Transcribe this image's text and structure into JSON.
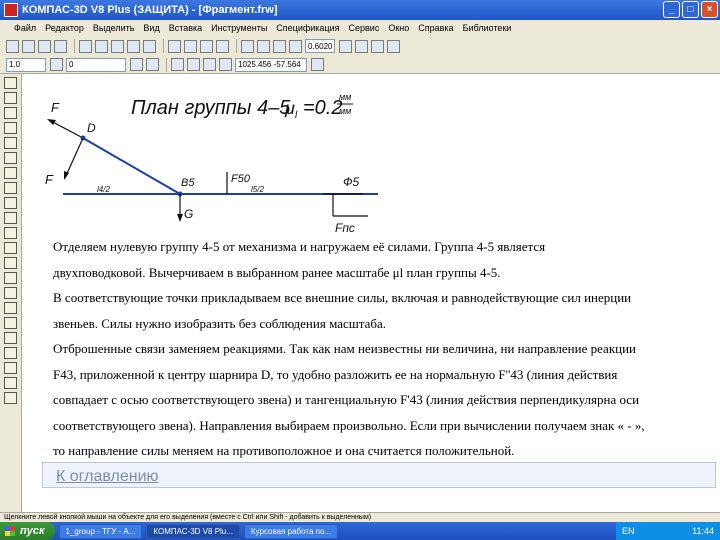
{
  "window": {
    "title": "КОМПАС-3D V8 Plus (ЗАЩИТА) - [Фрагмент.frw]",
    "controls": [
      "_",
      "□",
      "×"
    ]
  },
  "menu": [
    "Файл",
    "Редактор",
    "Выделить",
    "Вид",
    "Вставка",
    "Инструменты",
    "Спецификация",
    "Сервис",
    "Окно",
    "Справка",
    "Библиотеки"
  ],
  "toolbar": {
    "zoom_value": "0.6020",
    "style_value": "1.0",
    "layer_value": "0",
    "coords_value": "1025.456   -57.564"
  },
  "drawing": {
    "title": "План группы 4–5",
    "scale_symbol": "μ",
    "scale_sub": "l",
    "scale_value": "=0.2",
    "scale_num": "мм",
    "scale_den": "мм",
    "labels": {
      "D": "D",
      "F43n": "F",
      "F43t": "F",
      "B5": "B5",
      "G5": "G",
      "F50": "F50",
      "Phi5": "Ф5",
      "Fpc": "Fпс",
      "l4": "l4/2",
      "l5": "l5/2"
    }
  },
  "text": {
    "lines": [
      "    Отделяем нулевую группу 4-5 от механизма и нагружаем её силами. Группа 4-5 является",
      "двухповодковой. Вычерчиваем в выбранном ранее масштабе μl план группы 4-5.",
      "    В соответствующие точки прикладываем все внешние силы, включая и равнодействующие сил инерции",
      "звеньев. Силы нужно изобразить без соблюдения масштаба.",
      "    Отброшенные связи заменяем реакциями. Так как нам неизвестны ни величина, ни направление реакции",
      "F43, приложенной к центру шарнира D, то удобно разложить ее на нормальную  F''43  (линия действия",
      "совпадает с осью соответствующего звена) и тангенциальную  F'43  (линия действия перпендикулярна оси",
      "соответствующего звена). Направления выбираем произвольно. Если при вычислении получаем знак « - »,",
      "то направление силы меняем на противоположное и она считается положительной."
    ]
  },
  "link": "К оглавлению",
  "status": "Щелкните левой кнопкой мыши на объекте для его выделения (вместе с Ctrl или Shift - добавить к выделенным)",
  "taskbar": {
    "start": "пуск",
    "tasks": [
      "1_group - ТГУ - А...",
      "КОМПАС-3D V8 Plu...",
      "Курсовая работа по..."
    ],
    "tray_lang": "EN",
    "tray_time": "11:44"
  }
}
